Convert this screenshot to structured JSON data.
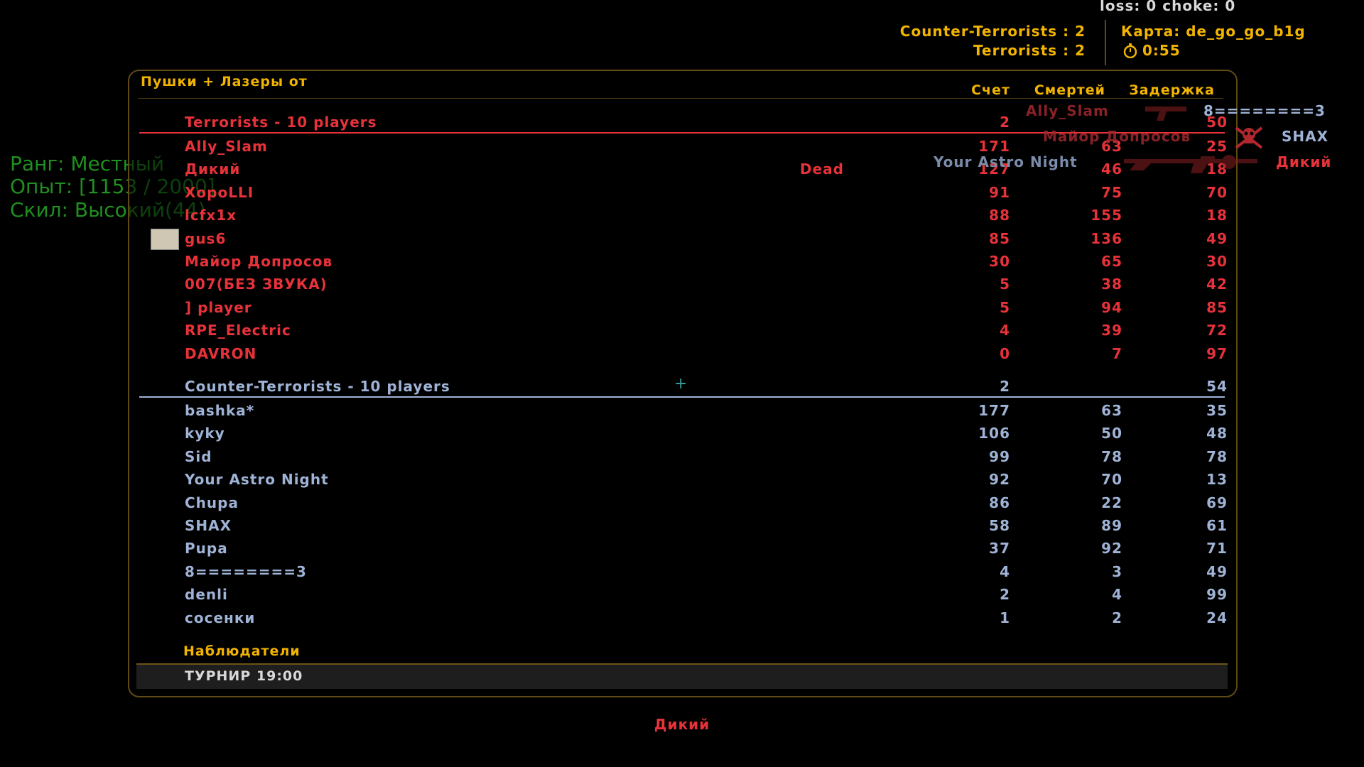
{
  "hud": {
    "net_status": "loss: 0 choke:  0",
    "score_ct": "Counter-Terrorists : 2",
    "score_t": "Terrorists : 2",
    "map": "Карта: de_go_go_b1g",
    "timer": "0:55",
    "icon": "stopwatch-icon"
  },
  "rank": {
    "rank": "Ранг: Местный",
    "exp": "Опыт: [1153 / 2000]",
    "skill": "Скил: Высокий(44)"
  },
  "board": {
    "title": "Пушки + Лазеры от",
    "col_score": "Счет",
    "col_deaths": "Смертей",
    "col_ping": "Задержка",
    "dead_label": "Dead",
    "spectators": "Наблюдатели",
    "footer": "ТУРНИР 19:00",
    "t": {
      "name": "Terrorists   -  10 players",
      "score": "2",
      "ping": "50",
      "color": "#e8323a",
      "players": [
        {
          "name": "Ally_Slam",
          "score": "171",
          "deaths": "63",
          "ping": "25"
        },
        {
          "name": "Дикий",
          "score": "127",
          "deaths": "46",
          "ping": "18"
        },
        {
          "name": "XopoLLI",
          "score": "91",
          "deaths": "75",
          "ping": "70"
        },
        {
          "name": "lcfx1x",
          "score": "88",
          "deaths": "155",
          "ping": "18"
        },
        {
          "name": "gus6",
          "score": "85",
          "deaths": "136",
          "ping": "49"
        },
        {
          "name": "Майор Допросов",
          "score": "30",
          "deaths": "65",
          "ping": "30"
        },
        {
          "name": "007(БЕЗ ЗВУКА)",
          "score": "5",
          "deaths": "38",
          "ping": "42"
        },
        {
          "name": "] player",
          "score": "5",
          "deaths": "94",
          "ping": "85"
        },
        {
          "name": "RPE_Electric",
          "score": "4",
          "deaths": "39",
          "ping": "72"
        },
        {
          "name": "DAVRON",
          "score": "0",
          "deaths": "7",
          "ping": "97"
        }
      ]
    },
    "ct": {
      "name": "Counter-Terrorists   -  10 players",
      "score": "2",
      "ping": "54",
      "color": "#9fb3d6",
      "players": [
        {
          "name": "bashka*",
          "score": "177",
          "deaths": "63",
          "ping": "35"
        },
        {
          "name": "kyky",
          "score": "106",
          "deaths": "50",
          "ping": "48"
        },
        {
          "name": "Sid",
          "score": "99",
          "deaths": "78",
          "ping": "78"
        },
        {
          "name": "Your Astro Night",
          "score": "92",
          "deaths": "70",
          "ping": "13"
        },
        {
          "name": "Chupa",
          "score": "86",
          "deaths": "22",
          "ping": "69"
        },
        {
          "name": "SHAX",
          "score": "58",
          "deaths": "89",
          "ping": "61"
        },
        {
          "name": "Pupa",
          "score": "37",
          "deaths": "92",
          "ping": "71"
        },
        {
          "name": "8========3",
          "score": "4",
          "deaths": "3",
          "ping": "49"
        },
        {
          "name": "denli",
          "score": "2",
          "deaths": "4",
          "ping": "99"
        },
        {
          "name": "сосенки",
          "score": "1",
          "deaths": "2",
          "ping": "24"
        }
      ]
    }
  },
  "killfeed": [
    {
      "attacker": "Ally_Slam",
      "victim": "8========3",
      "weapon_icon": "pistol-icon"
    },
    {
      "attacker": "Майор Допросов",
      "victim": "SHAX",
      "weapon_icon": "skull-icon"
    },
    {
      "attacker": "Your Astro Night",
      "victim": "Дикий",
      "weapon_icon": "rifle-icon"
    }
  ],
  "spectating": "Дикий"
}
